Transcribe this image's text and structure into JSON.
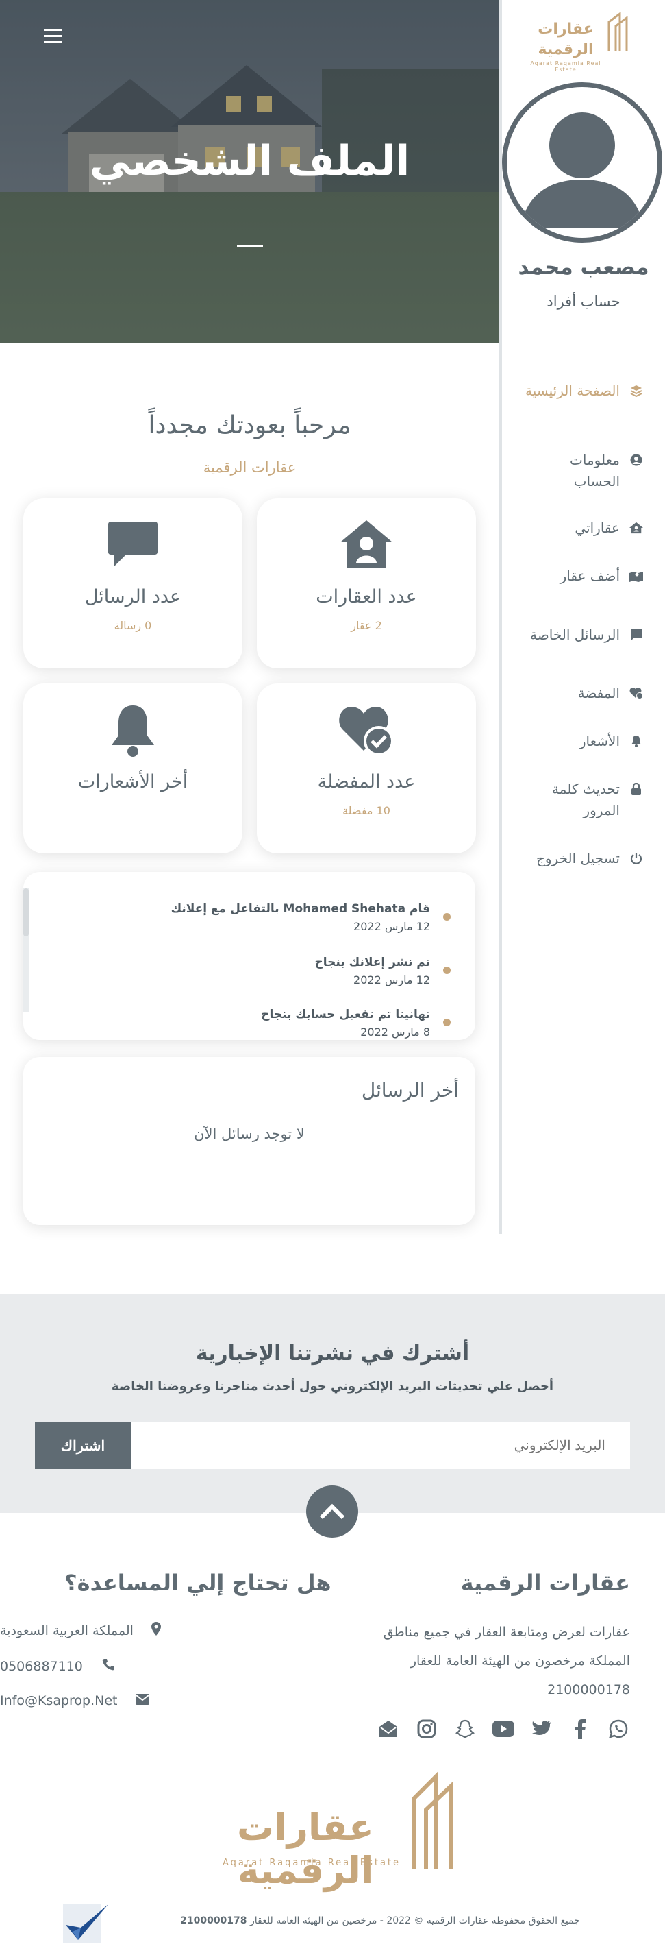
{
  "brand": {
    "name": "عقارات الرقمية",
    "tagline": "Aqarat Raqamia Real Estate"
  },
  "hero": {
    "title": "الملف الشخصي"
  },
  "user": {
    "name": "مصعب محمد",
    "account_type": "حساب أفراد"
  },
  "sidebar": {
    "items": [
      {
        "label": "الصفحة الرئيسية",
        "icon": "layers-icon"
      },
      {
        "label": "معلومات الحساب",
        "icon": "user-circle-icon"
      },
      {
        "label": "عقاراتي",
        "icon": "house-user-icon"
      },
      {
        "label": "أضف عقار",
        "icon": "map-marked-icon"
      },
      {
        "label": "الرسائل الخاصة",
        "icon": "message-icon"
      },
      {
        "label": "المفضة",
        "icon": "heart-check-icon"
      },
      {
        "label": "الأشعار",
        "icon": "bell-icon"
      },
      {
        "label": "تحديث كلمة المرور",
        "icon": "lock-icon"
      },
      {
        "label": "تسجيل الخروج",
        "icon": "power-icon"
      }
    ]
  },
  "welcome": {
    "title": "مرحباً بعودتك مجدداً",
    "subtitle": "عقارات الرقمية"
  },
  "cards": {
    "properties": {
      "title": "عدد العقارات",
      "value": "2 عقار"
    },
    "messages": {
      "title": "عدد الرسائل",
      "value": "0 رسالة"
    },
    "favorites": {
      "title": "عدد المفضلة",
      "value": "10 مفضلة"
    },
    "notifications": {
      "title": "أخر الأشعارات"
    }
  },
  "notifications": [
    {
      "text": "قام Mohamed Shehata بالتفاعل مع إعلانك",
      "date": "12 مارس 2022"
    },
    {
      "text": "تم نشر إعلانك بنجاح",
      "date": "12 مارس 2022"
    },
    {
      "text": "تهانينا تم تفعيل حسابك بنجاح",
      "date": "8 مارس 2022"
    }
  ],
  "latest_messages": {
    "title": "أخر الرسائل",
    "empty": "لا توجد رسائل الآن"
  },
  "newsletter": {
    "title": "أشترك في نشرتنا الإخبارية",
    "subtitle": "أحصل علي تحديثات البريد الإلكتروني حول أحدث متاجرنا وعروضنا الخاصة",
    "placeholder": "البريد الإلكتروني",
    "button": "اشتراك"
  },
  "footer": {
    "brand_title": "عقارات الرقمية",
    "brand_desc": "عقارات لعرض ومتابعة العقار في جميع مناطق المملكة مرخصون من الهيئة العامة للعقار 2100000178",
    "help_title": "هل تحتاج إلي المساعدة؟",
    "contacts": [
      {
        "text": "المملكة العربية السعودية",
        "icon": "map-marker-icon"
      },
      {
        "text": "0506887110",
        "icon": "phone-icon"
      },
      {
        "text": "Info@Ksaprop.Net",
        "icon": "envelope-icon"
      }
    ],
    "social": [
      "whatsapp-icon",
      "facebook-icon",
      "twitter-icon",
      "youtube-icon",
      "snapchat-icon",
      "instagram-icon",
      "mail-open-icon"
    ],
    "copyright_pre": "جميع الحقوق محفوظة عقارات الرقمية © 2022 - مرخصين من الهيئة العامة للعقار",
    "copyright_num": "2100000178"
  },
  "colors": {
    "accent": "#c7a77c",
    "primary": "#5f6b73",
    "newsletter_bg": "#e9ebed"
  }
}
